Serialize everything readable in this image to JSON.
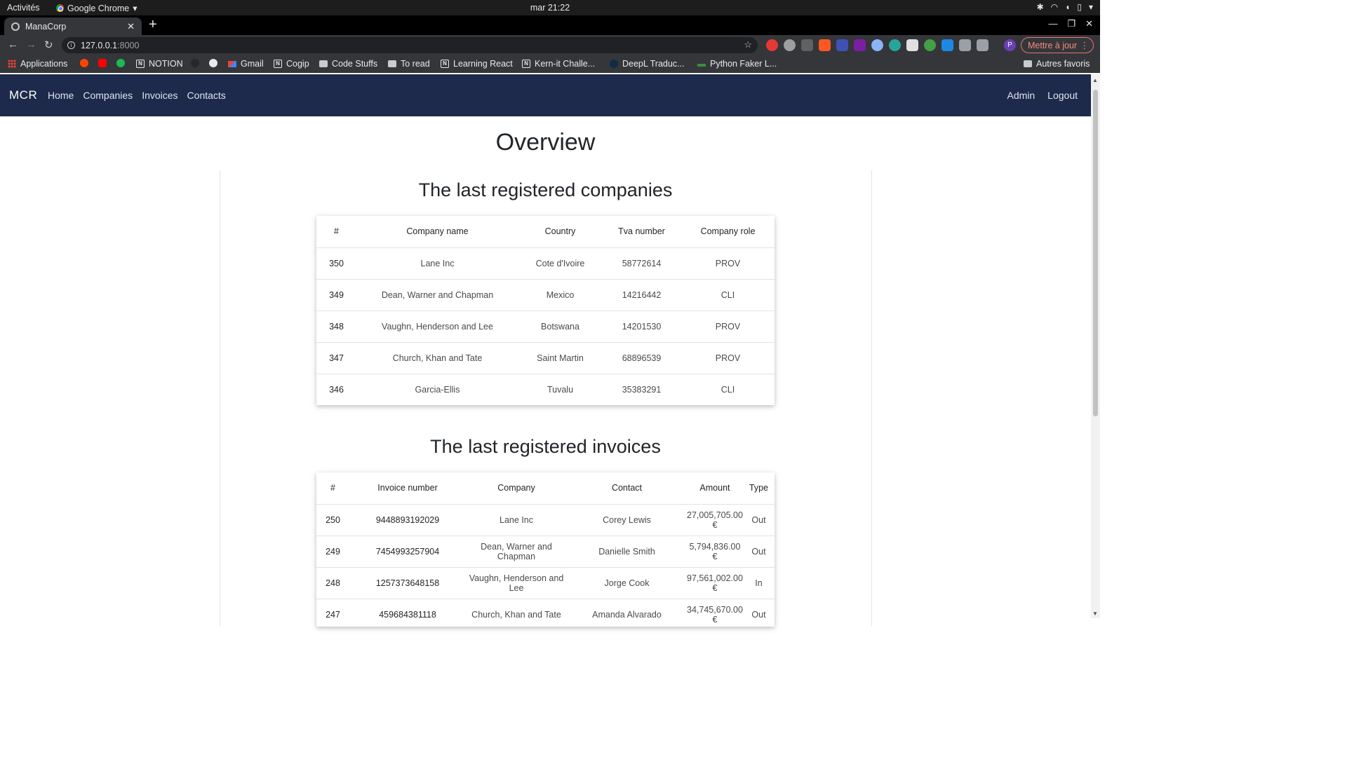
{
  "gnome": {
    "activities": "Activités",
    "app_name": "Google Chrome",
    "clock": "mar 21:22"
  },
  "browser": {
    "tab_title": "ManaCorp",
    "url_host": "127.0.0.1",
    "url_port": ":8000",
    "update_label": "Mettre à jour",
    "profile_initial": "P",
    "bookmarks": [
      {
        "label": "Applications",
        "icon": "apps-grid-icon"
      },
      {
        "label": "",
        "icon": "reddit-icon"
      },
      {
        "label": "",
        "icon": "youtube-icon"
      },
      {
        "label": "",
        "icon": "spotify-icon"
      },
      {
        "label": "NOTION",
        "icon": "notion-icon"
      },
      {
        "label": "",
        "icon": "github-icon"
      },
      {
        "label": "",
        "icon": "alien-icon"
      },
      {
        "label": "Gmail",
        "icon": "gmail-icon"
      },
      {
        "label": "Cogip",
        "icon": "notion-icon"
      },
      {
        "label": "Code Stuffs",
        "icon": "folder-icon"
      },
      {
        "label": "To read",
        "icon": "folder-icon"
      },
      {
        "label": "Learning React",
        "icon": "notion-icon"
      },
      {
        "label": "Kern-it Challe...",
        "icon": "notion-icon"
      },
      {
        "label": "DeepL Traduc...",
        "icon": "deepl-icon"
      },
      {
        "label": "Python Faker L...",
        "icon": "faker-icon"
      },
      {
        "label": "Autres favoris",
        "icon": "folder-icon"
      }
    ]
  },
  "navbar": {
    "brand": "MCR",
    "links": [
      "Home",
      "Companies",
      "Invoices",
      "Contacts"
    ],
    "right_links": [
      "Admin",
      "Logout"
    ]
  },
  "page": {
    "title": "Overview"
  },
  "companies": {
    "title": "The last registered companies",
    "headers": [
      "#",
      "Company name",
      "Country",
      "Tva number",
      "Company role"
    ],
    "rows": [
      [
        "350",
        "Lane Inc",
        "Cote d'Ivoire",
        "58772614",
        "PROV"
      ],
      [
        "349",
        "Dean, Warner and Chapman",
        "Mexico",
        "14216442",
        "CLI"
      ],
      [
        "348",
        "Vaughn, Henderson and Lee",
        "Botswana",
        "14201530",
        "PROV"
      ],
      [
        "347",
        "Church, Khan and Tate",
        "Saint Martin",
        "68896539",
        "PROV"
      ],
      [
        "346",
        "Garcia-Ellis",
        "Tuvalu",
        "35383291",
        "CLI"
      ]
    ]
  },
  "invoices": {
    "title": "The last registered invoices",
    "headers": [
      "#",
      "Invoice number",
      "Company",
      "Contact",
      "Amount",
      "Type"
    ],
    "rows": [
      [
        "250",
        "9448893192029",
        "Lane Inc",
        "Corey Lewis",
        "27,005,705.00 €",
        "Out"
      ],
      [
        "249",
        "7454993257904",
        "Dean, Warner and Chapman",
        "Danielle Smith",
        "5,794,836.00 €",
        "Out"
      ],
      [
        "248",
        "1257373648158",
        "Vaughn, Henderson and Lee",
        "Jorge Cook",
        "97,561,002.00 €",
        "In"
      ],
      [
        "247",
        "459684381118",
        "Church, Khan and Tate",
        "Amanda Alvarado",
        "34,745,670.00 €",
        "Out"
      ]
    ]
  }
}
